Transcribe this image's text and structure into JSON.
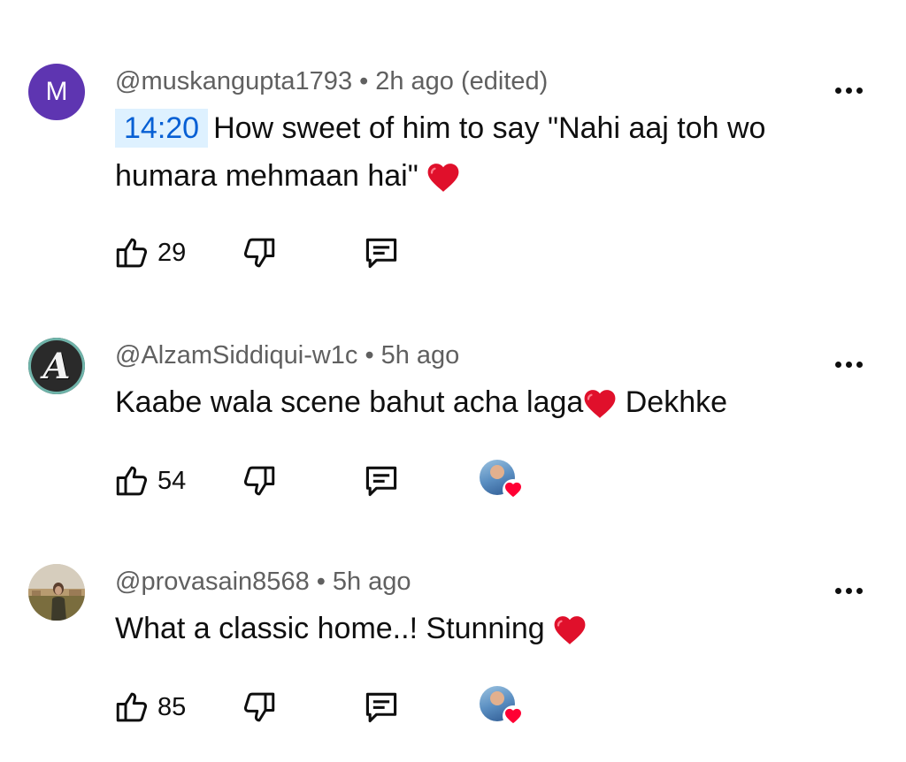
{
  "comments": [
    {
      "avatar_letter": "M",
      "avatar_color": "#5e35b1",
      "handle": "@muskangupta1793",
      "separator": "•",
      "time": "2h ago (edited)",
      "timestamp_link": "14:20",
      "text_line1": "How sweet of him to say \"Nahi aaj toh wo",
      "text_line2": "humara mehmaan hai\"",
      "likes": "29",
      "creator_hearted": false
    },
    {
      "avatar_letter": "A",
      "handle": "@AlzamSiddiqui-w1c",
      "separator": "•",
      "time": "5h ago",
      "text_before_heart": "Kaabe wala scene bahut acha laga",
      "text_after_heart": " Dekhke",
      "likes": "54",
      "creator_hearted": true
    },
    {
      "handle": "@provasain8568",
      "separator": "•",
      "time": "5h ago",
      "text": "What a classic home..! Stunning ",
      "likes": "85",
      "creator_hearted": true
    }
  ],
  "icons": {
    "like": "thumb-up-icon",
    "dislike": "thumb-down-icon",
    "reply": "reply-comment-icon",
    "more": "more-horizontal-icon",
    "heart": "red-heart-emoji",
    "creator_heart": "creator-heart-badge"
  },
  "colors": {
    "meta": "#606060",
    "text": "#0f0f0f",
    "timestamp_bg": "#def1ff",
    "timestamp_fg": "#065fd4",
    "heart": "#e0102b"
  }
}
